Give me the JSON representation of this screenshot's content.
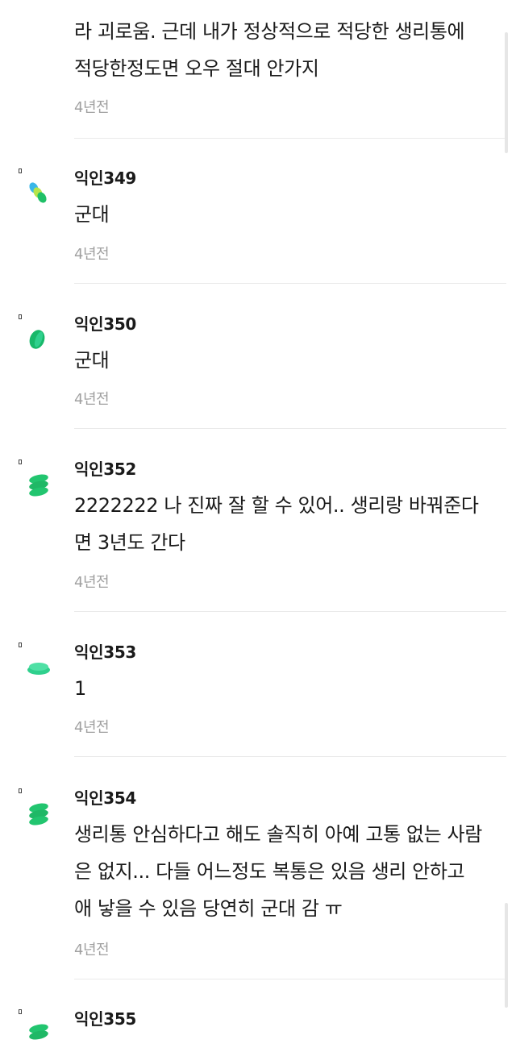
{
  "top_comment": {
    "lines": [
      "라 괴로움. 근데 내가 정상적으로 적당한 생리통에",
      "적당한정도면 오우 절대 안가지"
    ],
    "time": "4년전"
  },
  "comments": [
    {
      "author": "익인349",
      "lines": [
        "군대"
      ],
      "time": "4년전",
      "avatar_colors": [
        "#39b6e8",
        "#b6e44a",
        "#1fc067"
      ]
    },
    {
      "author": "익인350",
      "lines": [
        "군대"
      ],
      "time": "4년전",
      "avatar_colors": [
        "#18b86a"
      ]
    },
    {
      "author": "익인352",
      "lines": [
        "2222222 나 진짜 잘 할 수 있어.. 생리랑 바꿔준다",
        "면 3년도 간다"
      ],
      "time": "4년전",
      "avatar_colors": [
        "#22c56f"
      ]
    },
    {
      "author": "익인353",
      "lines": [
        "1"
      ],
      "time": "4년전",
      "avatar_colors": [
        "#2fd08d"
      ]
    },
    {
      "author": "익인354",
      "lines": [
        "생리통 안심하다고 해도 솔직히 아예 고통 없는 사람",
        "은 없지... 다들 어느정도 복통은 있음 생리 안하고",
        "애 낳을 수 있음 당연히 군대 감 ㅠ"
      ],
      "time": "4년전",
      "avatar_colors": [
        "#22c56f"
      ]
    },
    {
      "author": "익인355",
      "lines": [],
      "time": "",
      "avatar_colors": [
        "#22c56f"
      ]
    }
  ]
}
